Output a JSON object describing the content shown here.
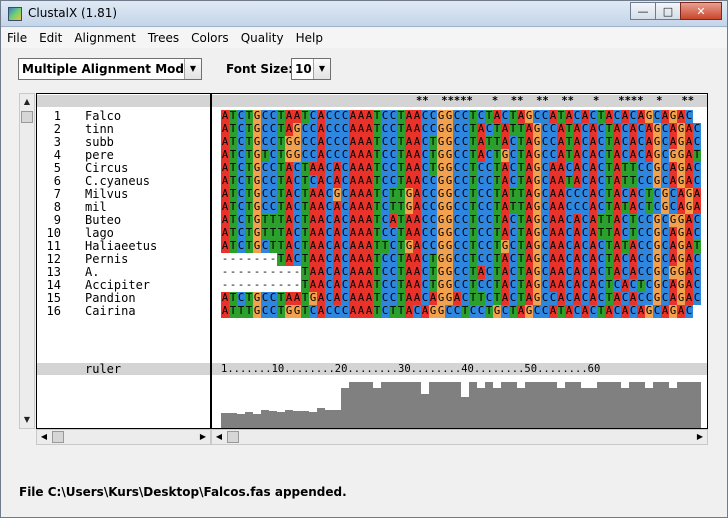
{
  "window": {
    "title": "ClustalX (1.81)"
  },
  "menu": [
    "File",
    "Edit",
    "Alignment",
    "Trees",
    "Colors",
    "Quality",
    "Help"
  ],
  "toolbar": {
    "mode_select": "Multiple Alignment Mode",
    "font_size_label": "Font Size:",
    "font_size_value": "10"
  },
  "alignment": {
    "consensus": "                               **  *****   *  **  **  **   *   ****  *   **  **   *  **  **",
    "sequences": [
      {
        "num": "1",
        "name": "Falco",
        "seq": "ATCTGCCTAATCACCCAAATCCTAACCGGCCTCTACTAGCCATACACTACACAGCAGAC"
      },
      {
        "num": "2",
        "name": "tinn",
        "seq": "ATCTGCCTAGCCACCCAAATCCTAACCGGCCTACTATTAGCCATACACTACACAGCAGAC"
      },
      {
        "num": "3",
        "name": "subb",
        "seq": "ATCTGCCTGGCCACCCAAATCCTAACTGGCCTATTACTAGCCATACACTACACAGCAGAC"
      },
      {
        "num": "4",
        "name": "pere",
        "seq": "ATCTGTCTGGCCACCCAAATCCTAACTGGCCTACTGCTAGCCATACACTACACAGCGGAT"
      },
      {
        "num": "5",
        "name": "Circus",
        "seq": "ATCTGCCTACTAACACAAATCCTAACTGGCCTCCTACTAGCAACACACTATTCCGCAGAC"
      },
      {
        "num": "6",
        "name": "C.cyaneus",
        "seq": "ATCTGCCTACTCACACAAATCCTAACCGGCCTCCTACTAGCAATACACTATTCCGCAGAC"
      },
      {
        "num": "7",
        "name": "Milvus",
        "seq": "ATCTGCCTACTAACGCAAATCTTGACCGGCCTCCTATTAGCAACCCACTACACTCGCAGAC"
      },
      {
        "num": "8",
        "name": "mil",
        "seq": "ATCTGCCTACTAACACAAATCTTGACCGGCCTCCTATTAGCAACCCACTATACTCGCAGAC"
      },
      {
        "num": "9",
        "name": "Buteo",
        "seq": "ATCTGTTTACTAACACAAATCATAACCGGCCTCCTACTAGCAACACATTACTCCGCGGAC"
      },
      {
        "num": "10",
        "name": "lago",
        "seq": "ATCTGTTTACTAACACAAATCCTAACCGGCCTCCTACTAGCAACACATTACTCCGCAGAC"
      },
      {
        "num": "11",
        "name": "Haliaeetus",
        "seq": "ATCTGCTTACTAACACAAATTCTGACCGGCCTCCTGCTAGCAACACACTATACCGCAGAT"
      },
      {
        "num": "12",
        "name": "Pernis",
        "seq": "-------TACTAACACAAATCCTAACTGGCCTCCTACTAGCAACACACTACACCGCAGAC"
      },
      {
        "num": "13",
        "name": "A.",
        "seq": "----------TAACACAAATCCTAACTGGCCTACTACTAGCAACACACTACACCGCGGAC"
      },
      {
        "num": "14",
        "name": "Accipiter",
        "seq": "----------TAACACAAATCCTAACTGGCCTCCTACTAGCAACACACTCACTCGCAGAC"
      },
      {
        "num": "15",
        "name": "Pandion",
        "seq": "ATCTGCCTAATGACACAAATCCTAACAGGACTTCTACTAGCCACACACTACACCGCAGAC"
      },
      {
        "num": "16",
        "name": "Cairina",
        "seq": "ATTTGCCTGGTCACCCAAATCTTACAGGCCTCCTGCTAGCCATACACTACACAGCAGAC"
      }
    ],
    "ruler_label": "ruler",
    "ruler": "1.......10........20........30........40........50........60",
    "quality": [
      0.32,
      0.32,
      0.3,
      0.34,
      0.3,
      0.38,
      0.36,
      0.34,
      0.38,
      0.36,
      0.36,
      0.34,
      0.42,
      0.38,
      0.38,
      0.8,
      0.92,
      0.92,
      0.92,
      0.8,
      0.92,
      0.92,
      0.92,
      0.92,
      0.92,
      0.7,
      0.92,
      0.92,
      0.92,
      0.92,
      0.64,
      0.92,
      0.8,
      0.92,
      0.8,
      0.92,
      0.92,
      0.8,
      0.92,
      0.92,
      0.92,
      0.92,
      0.8,
      0.92,
      0.92,
      0.8,
      0.8,
      0.92,
      0.92,
      0.92,
      0.8,
      0.92,
      0.92,
      0.8,
      0.92,
      0.92,
      0.8,
      0.92,
      0.92,
      0.92
    ]
  },
  "status": "File C:\\Users\\Kurs\\Desktop\\Falcos.fas appended."
}
